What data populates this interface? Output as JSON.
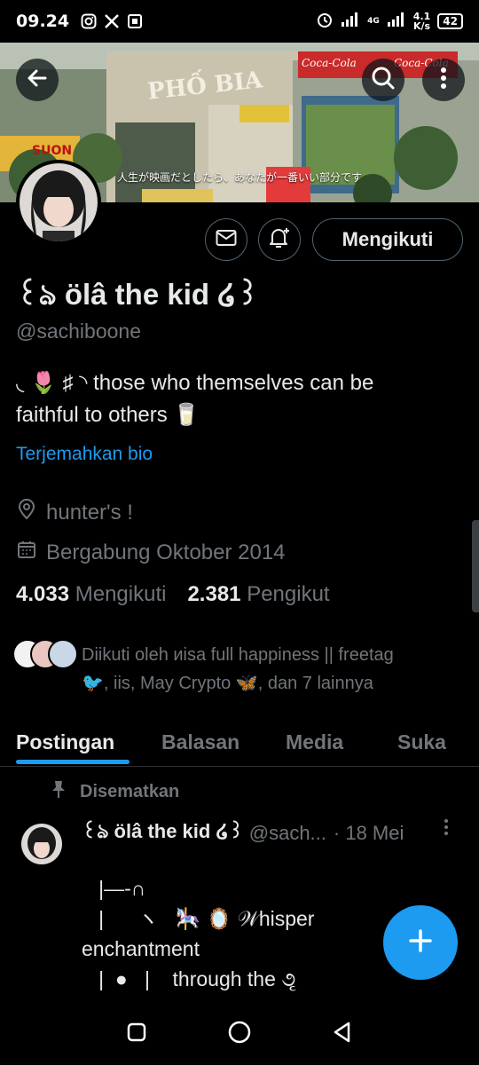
{
  "status_bar": {
    "time": "09.24",
    "network": "4G",
    "speed": "4.1",
    "speed_unit": "K/s",
    "battery": "42"
  },
  "banner": {
    "caption": "人生が映画だとしたら、あなたが一番いい部分です",
    "shop_sign": "PHỐ BIA",
    "sign_left": "SUON",
    "sign_right": "Coca-Cola",
    "sign_small": "Coca-Cola"
  },
  "header": {
    "back_icon": "arrow-left-icon",
    "search_icon": "search-icon",
    "more_icon": "more-vertical-icon"
  },
  "profile": {
    "name": "꒰ঌ ölâ the kid ໒꒱",
    "handle": "@sachiboone",
    "bio_line1": "◟ 🌷 ♯   ◝ those who themselves can be",
    "bio_line2": "faithful to others 🥛",
    "translate_label": "Terjemahkan bio",
    "location": "hunter's !",
    "joined": "Bergabung Oktober 2014",
    "following_count": "4.033",
    "following_label": "Mengikuti",
    "followers_count": "2.381",
    "followers_label": "Pengikut",
    "followed_by_line1": "Diikuti oleh иisa full happiness || freetag",
    "followed_by_line2": "🐦, iis, May Crypto 🦋, dan 7 lainnya"
  },
  "actions": {
    "message_icon": "envelope-icon",
    "notify_icon": "bell-plus-icon",
    "follow_label": "Mengikuti"
  },
  "tabs": [
    {
      "label": "Postingan",
      "active": true
    },
    {
      "label": "Balasan",
      "active": false
    },
    {
      "label": "Media",
      "active": false
    },
    {
      "label": "Suka",
      "active": false
    }
  ],
  "pinned_post": {
    "pinned_label": "Disematkan",
    "author": "꒰ঌ ölâ the kid ໒꒱",
    "handle": "@sach...",
    "time": "· 18 Mei",
    "body": "   |—-∩\n   |      ヽ   🎠 🪞 𝒲hisper\nenchantment\n   |  ●   |    through the ૭ૃ"
  },
  "colors": {
    "accent": "#1d9bf0",
    "background": "#000000",
    "text_primary": "#e7e9ea",
    "text_secondary": "#71767b",
    "border": "#536471"
  }
}
